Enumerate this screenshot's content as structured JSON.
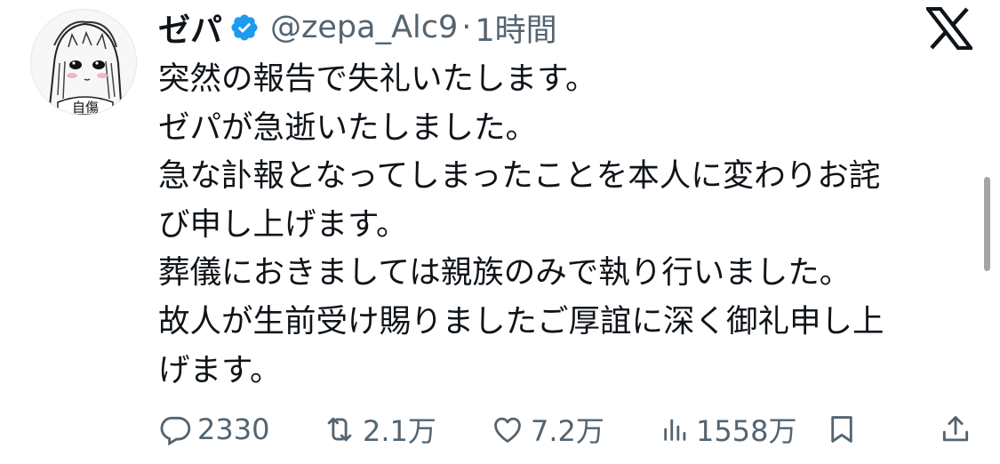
{
  "author": {
    "name": "ゼパ",
    "handle": "@zepa_Alc9",
    "separator": "·",
    "time": "1時間",
    "avatar_text": "自傷"
  },
  "tweet": {
    "lines": [
      "突然の報告で失礼いたします。",
      "ゼパが急逝いたしました。",
      "急な訃報となってしまったことを本人に変わりお詫",
      "び申し上げます。",
      "葬儀におきましては親族のみで執り行いました。",
      "故人が生前受け賜りましたご厚誼に深く御礼申し上",
      "げます。"
    ]
  },
  "actions": {
    "replies": "2330",
    "reposts": "2.1万",
    "likes": "7.2万",
    "views": "1558万"
  },
  "icons": [
    "verified-badge-icon",
    "x-logo-icon",
    "reply-icon",
    "repost-icon",
    "like-icon",
    "views-icon",
    "bookmark-icon",
    "share-icon"
  ],
  "colors": {
    "text": "#0f1419",
    "secondary": "#536471",
    "verified": "#1d9bf0"
  }
}
